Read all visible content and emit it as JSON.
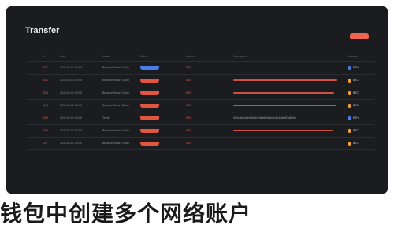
{
  "window": {
    "title": "Transfer"
  },
  "table": {
    "headers": [
      "#",
      "Date",
      "Name",
      "Status",
      "Amount",
      "Description",
      "Network"
    ],
    "rows": [
      {
        "num": "001",
        "date": "2019.01.01 00:00",
        "name": "Binance Smart Chain",
        "status_kind": "blue",
        "amount": "0.00",
        "desc_kind": "text",
        "desc": "",
        "network": "ETH",
        "net_color": "#4b7de8"
      },
      {
        "num": "002",
        "date": "2019.01.01 00:00",
        "name": "Binance Smart Chain",
        "status_kind": "red",
        "amount": "0.00",
        "desc_kind": "bar",
        "desc": "",
        "network": "BTC",
        "net_color": "#f0a030"
      },
      {
        "num": "003",
        "date": "2019.01.01 00:00",
        "name": "Binance Smart Chain",
        "status_kind": "red",
        "amount": "0.00",
        "desc_kind": "bar",
        "desc": "",
        "network": "BTC",
        "net_color": "#f0a030"
      },
      {
        "num": "004",
        "date": "2019.01.01 00:00",
        "name": "Binance Smart Chain",
        "status_kind": "red",
        "amount": "0.00",
        "desc_kind": "bar",
        "desc": "",
        "network": "BTC",
        "net_color": "#f0a030"
      },
      {
        "num": "005",
        "date": "2019.01.01 00:00",
        "name": "Tether",
        "status_kind": "red",
        "amount": "0.00",
        "desc_kind": "text",
        "desc": "0x0c3b2a1e4f5d6c7b8a9e0f1d2c3b4a5e6f7d8c9b",
        "network": "ETH",
        "net_color": "#4b7de8"
      },
      {
        "num": "006",
        "date": "2019.01.01 00:00",
        "name": "Binance Smart Chain",
        "status_kind": "red",
        "amount": "0.00",
        "desc_kind": "bar",
        "desc": "",
        "network": "BTC",
        "net_color": "#f0a030"
      },
      {
        "num": "007",
        "date": "2019.01.01 00:00",
        "name": "Binance Smart Chain",
        "status_kind": "red",
        "amount": "0.00",
        "desc_kind": "none",
        "desc": "",
        "network": "BTC",
        "net_color": "#f0a030"
      }
    ]
  },
  "caption": "钱包中创建多个网络账户"
}
